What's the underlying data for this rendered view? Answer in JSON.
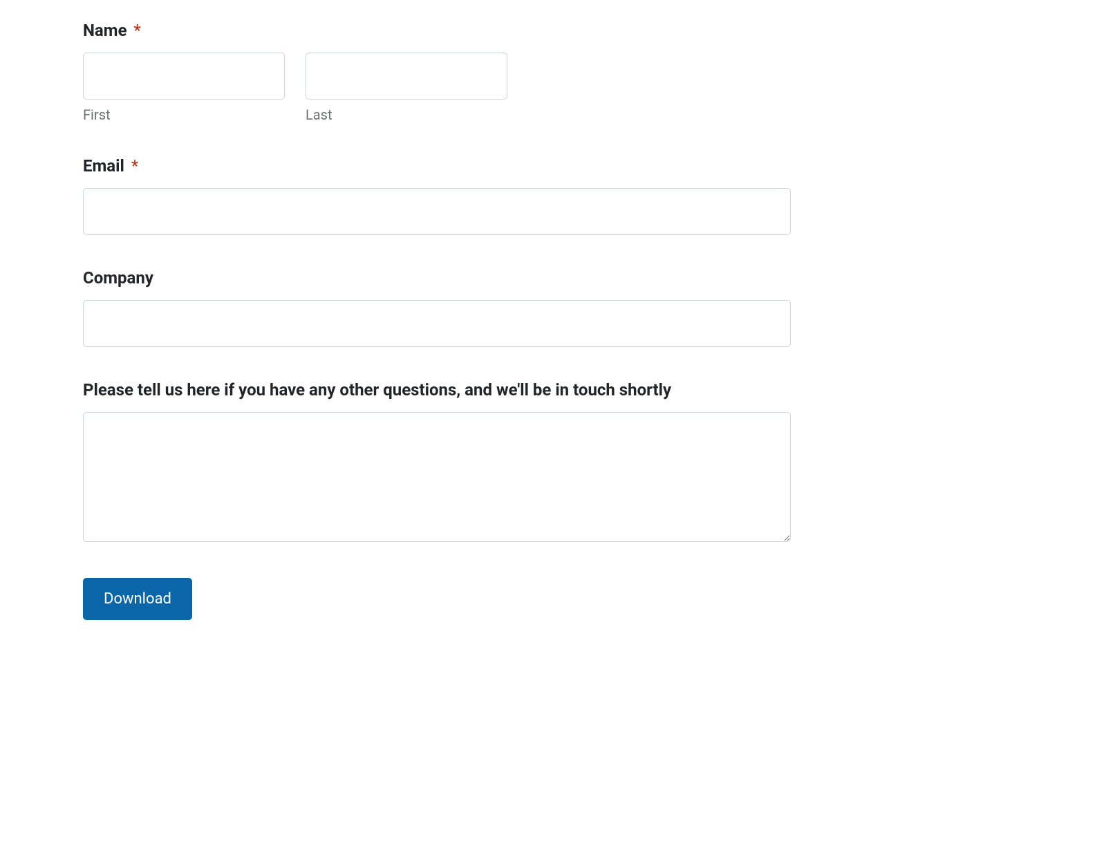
{
  "form": {
    "name": {
      "label": "Name",
      "required_mark": "*",
      "first": {
        "value": "",
        "sub_label": "First"
      },
      "last": {
        "value": "",
        "sub_label": "Last"
      }
    },
    "email": {
      "label": "Email",
      "required_mark": "*",
      "value": ""
    },
    "company": {
      "label": "Company",
      "value": ""
    },
    "questions": {
      "label": "Please tell us here if you have any other questions, and we'll be in touch shortly",
      "value": ""
    },
    "submit": {
      "label": "Download"
    }
  }
}
